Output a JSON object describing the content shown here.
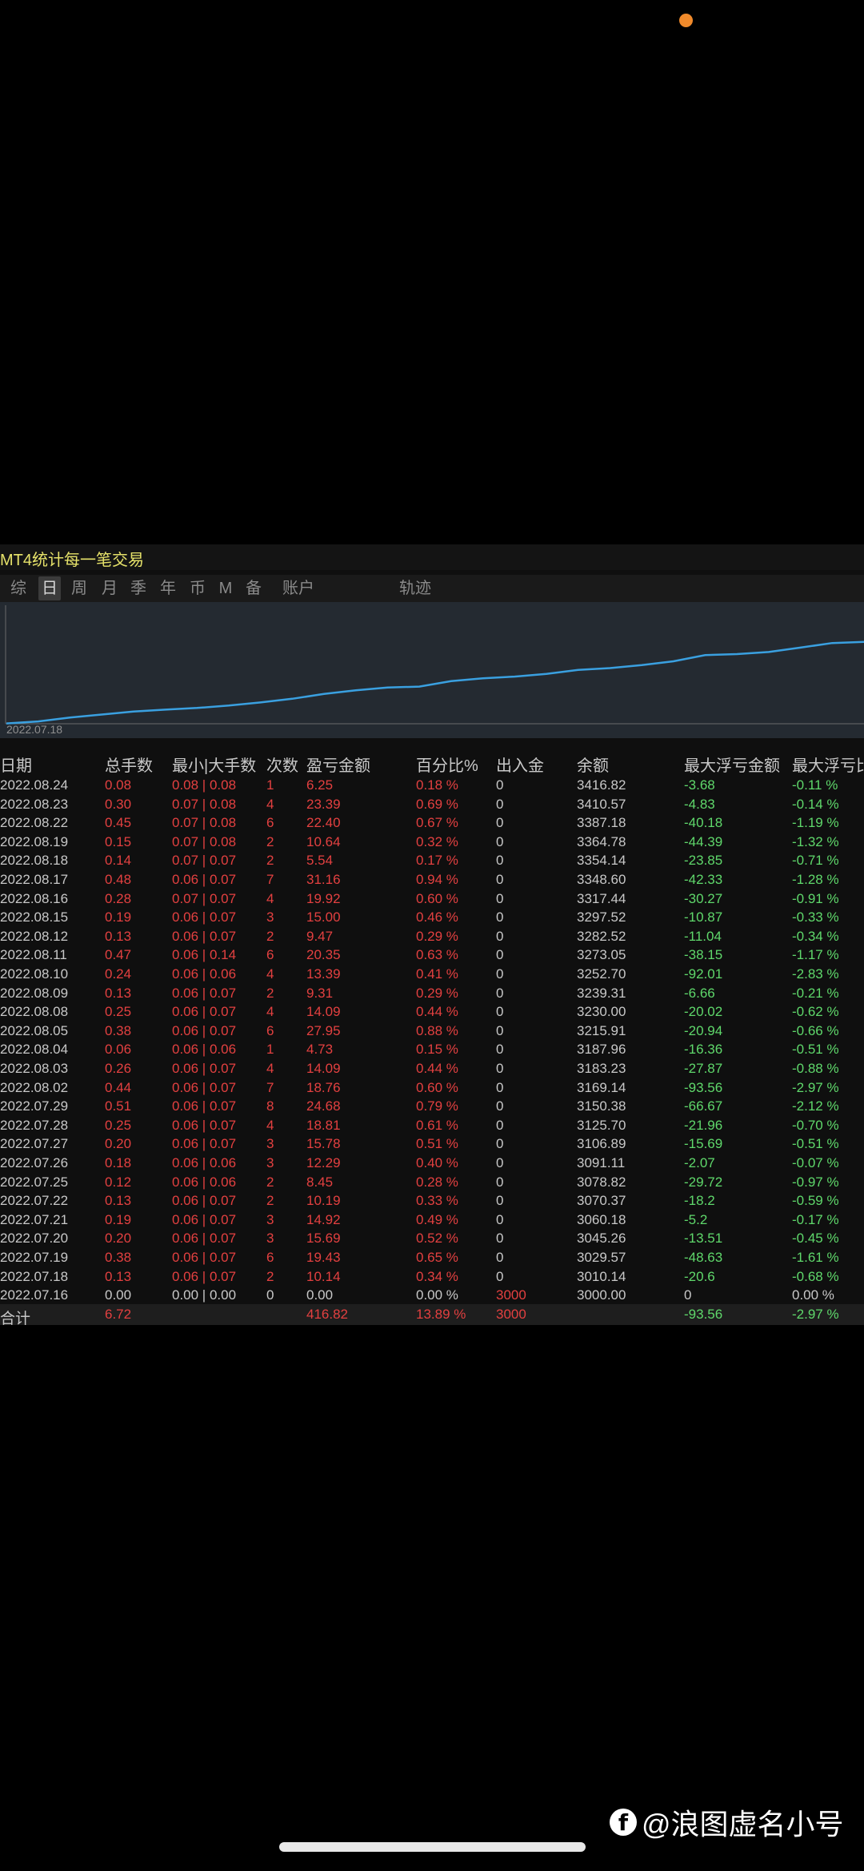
{
  "app": {
    "title": "MT4统计每一笔交易"
  },
  "tabs": [
    {
      "label": "综",
      "active": false
    },
    {
      "label": "日",
      "active": true
    },
    {
      "label": "周",
      "active": false
    },
    {
      "label": "月",
      "active": false
    },
    {
      "label": "季",
      "active": false
    },
    {
      "label": "年",
      "active": false
    },
    {
      "label": "币",
      "active": false
    },
    {
      "label": "M",
      "active": false
    },
    {
      "label": "备",
      "active": false
    },
    {
      "label": "账户",
      "active": false
    },
    {
      "label": "轨迹",
      "active": false
    }
  ],
  "chart_data": {
    "type": "line",
    "start_label": "2022.07.18",
    "x": [
      "2022.07.16",
      "2022.07.18",
      "2022.07.19",
      "2022.07.20",
      "2022.07.21",
      "2022.07.22",
      "2022.07.25",
      "2022.07.26",
      "2022.07.27",
      "2022.07.28",
      "2022.07.29",
      "2022.08.02",
      "2022.08.03",
      "2022.08.04",
      "2022.08.05",
      "2022.08.08",
      "2022.08.09",
      "2022.08.10",
      "2022.08.11",
      "2022.08.12",
      "2022.08.15",
      "2022.08.16",
      "2022.08.17",
      "2022.08.18",
      "2022.08.19",
      "2022.08.22",
      "2022.08.23",
      "2022.08.24"
    ],
    "y": [
      3000.0,
      3010.14,
      3029.57,
      3045.26,
      3060.18,
      3070.37,
      3078.82,
      3091.11,
      3106.89,
      3125.7,
      3150.38,
      3169.14,
      3183.23,
      3187.96,
      3215.91,
      3230.0,
      3239.31,
      3252.7,
      3273.05,
      3282.52,
      3297.52,
      3317.44,
      3348.6,
      3354.14,
      3364.78,
      3387.18,
      3410.57,
      3416.82
    ],
    "line_color": "#3aa0e0"
  },
  "table": {
    "headers": [
      "日期",
      "总手数",
      "最小|大手数",
      "次数",
      "盈亏金额",
      "百分比%",
      "出入金",
      "余额",
      "最大浮亏金额",
      "最大浮亏比"
    ],
    "rows": [
      [
        "2022.08.24",
        "0.08",
        "0.08 | 0.08",
        "1",
        "6.25",
        "0.18 %",
        "0",
        "3416.82",
        "-3.68",
        "-0.11 %"
      ],
      [
        "2022.08.23",
        "0.30",
        "0.07 | 0.08",
        "4",
        "23.39",
        "0.69 %",
        "0",
        "3410.57",
        "-4.83",
        "-0.14 %"
      ],
      [
        "2022.08.22",
        "0.45",
        "0.07 | 0.08",
        "6",
        "22.40",
        "0.67 %",
        "0",
        "3387.18",
        "-40.18",
        "-1.19 %"
      ],
      [
        "2022.08.19",
        "0.15",
        "0.07 | 0.08",
        "2",
        "10.64",
        "0.32 %",
        "0",
        "3364.78",
        "-44.39",
        "-1.32 %"
      ],
      [
        "2022.08.18",
        "0.14",
        "0.07 | 0.07",
        "2",
        "5.54",
        "0.17 %",
        "0",
        "3354.14",
        "-23.85",
        "-0.71 %"
      ],
      [
        "2022.08.17",
        "0.48",
        "0.06 | 0.07",
        "7",
        "31.16",
        "0.94 %",
        "0",
        "3348.60",
        "-42.33",
        "-1.28 %"
      ],
      [
        "2022.08.16",
        "0.28",
        "0.07 | 0.07",
        "4",
        "19.92",
        "0.60 %",
        "0",
        "3317.44",
        "-30.27",
        "-0.91 %"
      ],
      [
        "2022.08.15",
        "0.19",
        "0.06 | 0.07",
        "3",
        "15.00",
        "0.46 %",
        "0",
        "3297.52",
        "-10.87",
        "-0.33 %"
      ],
      [
        "2022.08.12",
        "0.13",
        "0.06 | 0.07",
        "2",
        "9.47",
        "0.29 %",
        "0",
        "3282.52",
        "-11.04",
        "-0.34 %"
      ],
      [
        "2022.08.11",
        "0.47",
        "0.06 | 0.14",
        "6",
        "20.35",
        "0.63 %",
        "0",
        "3273.05",
        "-38.15",
        "-1.17 %"
      ],
      [
        "2022.08.10",
        "0.24",
        "0.06 | 0.06",
        "4",
        "13.39",
        "0.41 %",
        "0",
        "3252.70",
        "-92.01",
        "-2.83 %"
      ],
      [
        "2022.08.09",
        "0.13",
        "0.06 | 0.07",
        "2",
        "9.31",
        "0.29 %",
        "0",
        "3239.31",
        "-6.66",
        "-0.21 %"
      ],
      [
        "2022.08.08",
        "0.25",
        "0.06 | 0.07",
        "4",
        "14.09",
        "0.44 %",
        "0",
        "3230.00",
        "-20.02",
        "-0.62 %"
      ],
      [
        "2022.08.05",
        "0.38",
        "0.06 | 0.07",
        "6",
        "27.95",
        "0.88 %",
        "0",
        "3215.91",
        "-20.94",
        "-0.66 %"
      ],
      [
        "2022.08.04",
        "0.06",
        "0.06 | 0.06",
        "1",
        "4.73",
        "0.15 %",
        "0",
        "3187.96",
        "-16.36",
        "-0.51 %"
      ],
      [
        "2022.08.03",
        "0.26",
        "0.06 | 0.07",
        "4",
        "14.09",
        "0.44 %",
        "0",
        "3183.23",
        "-27.87",
        "-0.88 %"
      ],
      [
        "2022.08.02",
        "0.44",
        "0.06 | 0.07",
        "7",
        "18.76",
        "0.60 %",
        "0",
        "3169.14",
        "-93.56",
        "-2.97 %"
      ],
      [
        "2022.07.29",
        "0.51",
        "0.06 | 0.07",
        "8",
        "24.68",
        "0.79 %",
        "0",
        "3150.38",
        "-66.67",
        "-2.12 %"
      ],
      [
        "2022.07.28",
        "0.25",
        "0.06 | 0.07",
        "4",
        "18.81",
        "0.61 %",
        "0",
        "3125.70",
        "-21.96",
        "-0.70 %"
      ],
      [
        "2022.07.27",
        "0.20",
        "0.06 | 0.07",
        "3",
        "15.78",
        "0.51 %",
        "0",
        "3106.89",
        "-15.69",
        "-0.51 %"
      ],
      [
        "2022.07.26",
        "0.18",
        "0.06 | 0.06",
        "3",
        "12.29",
        "0.40 %",
        "0",
        "3091.11",
        "-2.07",
        "-0.07 %"
      ],
      [
        "2022.07.25",
        "0.12",
        "0.06 | 0.06",
        "2",
        "8.45",
        "0.28 %",
        "0",
        "3078.82",
        "-29.72",
        "-0.97 %"
      ],
      [
        "2022.07.22",
        "0.13",
        "0.06 | 0.07",
        "2",
        "10.19",
        "0.33 %",
        "0",
        "3070.37",
        "-18.2",
        "-0.59 %"
      ],
      [
        "2022.07.21",
        "0.19",
        "0.06 | 0.07",
        "3",
        "14.92",
        "0.49 %",
        "0",
        "3060.18",
        "-5.2",
        "-0.17 %"
      ],
      [
        "2022.07.20",
        "0.20",
        "0.06 | 0.07",
        "3",
        "15.69",
        "0.52 %",
        "0",
        "3045.26",
        "-13.51",
        "-0.45 %"
      ],
      [
        "2022.07.19",
        "0.38",
        "0.06 | 0.07",
        "6",
        "19.43",
        "0.65 %",
        "0",
        "3029.57",
        "-48.63",
        "-1.61 %"
      ],
      [
        "2022.07.18",
        "0.13",
        "0.06 | 0.07",
        "2",
        "10.14",
        "0.34 %",
        "0",
        "3010.14",
        "-20.6",
        "-0.68 %"
      ],
      [
        "2022.07.16",
        "0.00",
        "0.00 | 0.00",
        "0",
        "0.00",
        "0.00 %",
        "3000",
        "3000.00",
        "0",
        "0.00 %"
      ]
    ],
    "total": [
      "合计",
      "6.72",
      "",
      "",
      "416.82",
      "13.89 %",
      "3000",
      "",
      "-93.56",
      "-2.97 %"
    ]
  },
  "watermark": {
    "icon": "facebook-icon",
    "text": "@浪图虚名小号"
  },
  "colors": {
    "red": "#e34040",
    "green": "#5fd86b",
    "gray": "#c8c8c8",
    "title": "#e6e26a",
    "line": "#3aa0e0"
  }
}
